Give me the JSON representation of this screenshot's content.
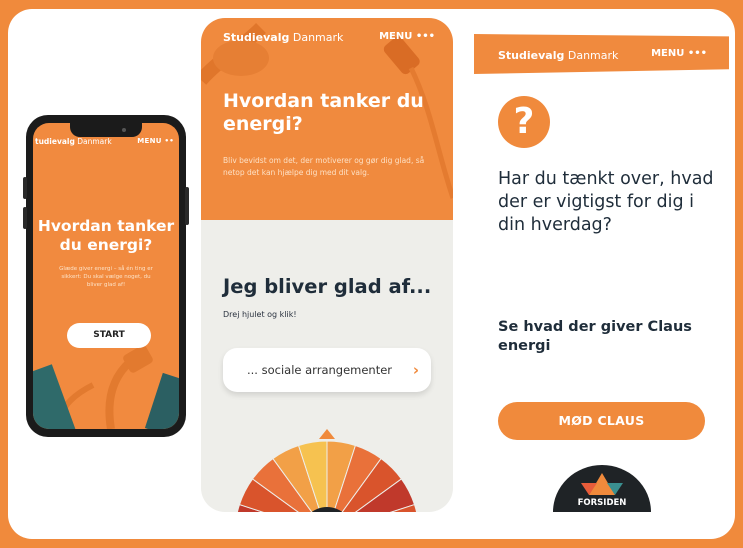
{
  "phone": {
    "brand_bold": "tudievalg",
    "brand_light": " Danmark",
    "menu": "MENU ••",
    "title": "Hvordan tanker du energi?",
    "subtitle": "Glæde giver energi – så én ting er sikkert: Du skal vælge noget, du bliver glad af!",
    "start_label": "START"
  },
  "panel2": {
    "brand_bold": "Studievalg",
    "brand_light": " Danmark",
    "menu": "MENU •••",
    "title": "Hvordan tanker du energi?",
    "subtitle": "Bliv bevidst om det, der motiverer og gør dig glad, så netop det kan hjælpe dig med dit valg.",
    "heading": "Jeg bliver glad af...",
    "hint": "Drej hjulet og klik!",
    "select_value": "... sociale arrangementer",
    "colors": {
      "accent": "#f08a3c",
      "wheel": [
        "#c0392b",
        "#d9542c",
        "#e9713a",
        "#f2a047",
        "#f6c250",
        "#f2a047",
        "#e9713a",
        "#d9542c"
      ]
    }
  },
  "panel3": {
    "brand_bold": "Studievalg",
    "brand_light": " Danmark",
    "menu": "MENU •••",
    "icon": "question-mark-icon",
    "question": "Har du tænkt over, hvad der er vigtigst for dig i din hverdag?",
    "claus_heading": "Se hvad der giver Claus energi",
    "button_label": "MØD CLAUS",
    "badge_label": "FORSIDEN"
  }
}
